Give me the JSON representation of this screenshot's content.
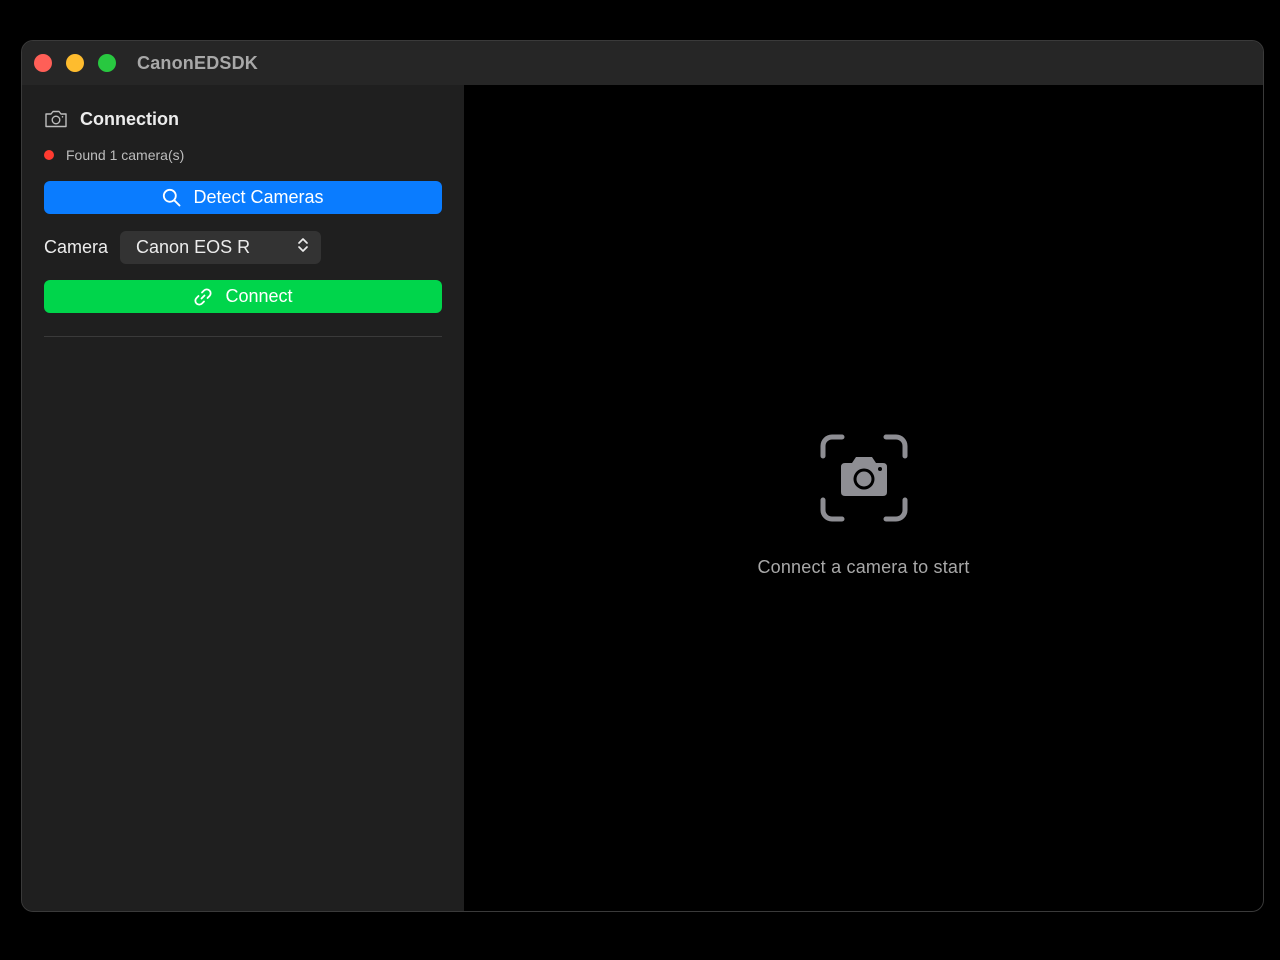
{
  "window": {
    "title": "CanonEDSDK"
  },
  "sidebar": {
    "section_title": "Connection",
    "section_icon": "camera-icon",
    "status": {
      "text": "Found 1 camera(s)",
      "color": "#ff3b30"
    },
    "detect_button": {
      "label": "Detect Cameras",
      "icon": "search-icon",
      "color": "#0a7cff"
    },
    "camera_picker": {
      "label": "Camera",
      "selected": "Canon EOS R",
      "icon": "chevron-up-down-icon"
    },
    "connect_button": {
      "label": "Connect",
      "icon": "link-icon",
      "color": "#00d54b"
    }
  },
  "detail": {
    "placeholder_icon": "camera-viewfinder-icon",
    "placeholder_text": "Connect a camera to start"
  }
}
